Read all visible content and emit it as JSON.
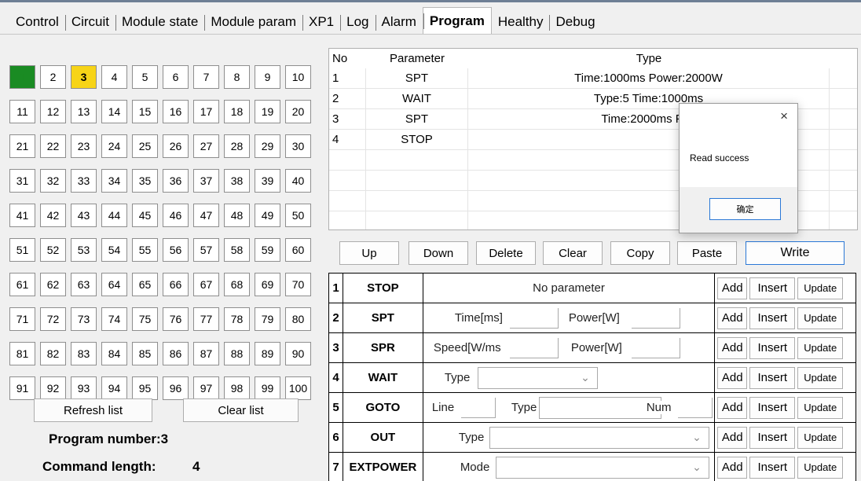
{
  "tabs": [
    "Control",
    "Circuit",
    "Module state",
    "Module param",
    "XP1",
    "Log",
    "Alarm",
    "Program",
    "Healthy",
    "Debug"
  ],
  "active_tab": "Program",
  "modules": {
    "cells": [
      "1",
      "2",
      "3",
      "4",
      "5",
      "6",
      "7",
      "8",
      "9",
      "10",
      "11",
      "12",
      "13",
      "14",
      "15",
      "16",
      "17",
      "18",
      "19",
      "20",
      "21",
      "22",
      "23",
      "24",
      "25",
      "26",
      "27",
      "28",
      "29",
      "30",
      "31",
      "32",
      "33",
      "34",
      "35",
      "36",
      "37",
      "38",
      "39",
      "40",
      "41",
      "42",
      "43",
      "44",
      "45",
      "46",
      "47",
      "48",
      "49",
      "50",
      "51",
      "52",
      "53",
      "54",
      "55",
      "56",
      "57",
      "58",
      "59",
      "60",
      "61",
      "62",
      "63",
      "64",
      "65",
      "66",
      "67",
      "68",
      "69",
      "70",
      "71",
      "72",
      "73",
      "74",
      "75",
      "76",
      "77",
      "78",
      "79",
      "80",
      "81",
      "82",
      "83",
      "84",
      "85",
      "86",
      "87",
      "88",
      "89",
      "90",
      "91",
      "92",
      "93",
      "94",
      "95",
      "96",
      "97",
      "98",
      "99",
      "100"
    ],
    "green_cell": "1",
    "selected_cell": "3",
    "green_color": "#1a8b23",
    "selected_color": "#f7d417"
  },
  "left_buttons": {
    "refresh": "Refresh list",
    "clear": "Clear list"
  },
  "program_info": {
    "number_label": "Program number:3",
    "length_label": "Command length:",
    "length_value": "4"
  },
  "program_table": {
    "headers": {
      "no": "No",
      "parameter": "Parameter",
      "type": "Type"
    },
    "rows": [
      {
        "no": "1",
        "param": "SPT",
        "type": "Time:1000ms  Power:2000W"
      },
      {
        "no": "2",
        "param": "WAIT",
        "type": "Type:5 Time:1000ms"
      },
      {
        "no": "3",
        "param": "SPT",
        "type": "Time:2000ms  Pov"
      },
      {
        "no": "4",
        "param": "STOP",
        "type": ""
      },
      {
        "no": "",
        "param": "",
        "type": ""
      },
      {
        "no": "",
        "param": "",
        "type": ""
      },
      {
        "no": "",
        "param": "",
        "type": ""
      },
      {
        "no": "",
        "param": "",
        "type": ""
      }
    ]
  },
  "actions": {
    "up": "Up",
    "down": "Down",
    "delete": "Delete",
    "clear": "Clear",
    "copy": "Copy",
    "paste": "Paste",
    "write": "Write"
  },
  "commands": {
    "add": "Add",
    "insert": "Insert",
    "update": "Update",
    "rows": [
      {
        "num": "1",
        "name": "STOP",
        "no_param": "No parameter"
      },
      {
        "num": "2",
        "name": "SPT",
        "time_label": "Time[ms]",
        "power_label": "Power[W]"
      },
      {
        "num": "3",
        "name": "SPR",
        "speed_label": "Speed[W/ms",
        "power_label": "Power[W]"
      },
      {
        "num": "4",
        "name": "WAIT",
        "type_label": "Type"
      },
      {
        "num": "5",
        "name": "GOTO",
        "line_label": "Line",
        "type_label": "Type",
        "num_label": "Num"
      },
      {
        "num": "6",
        "name": "OUT",
        "type_label": "Type"
      },
      {
        "num": "7",
        "name": "EXTPOWER",
        "mode_label": "Mode"
      }
    ]
  },
  "dialog": {
    "close": "×",
    "message": "Read success",
    "ok": "确定"
  }
}
